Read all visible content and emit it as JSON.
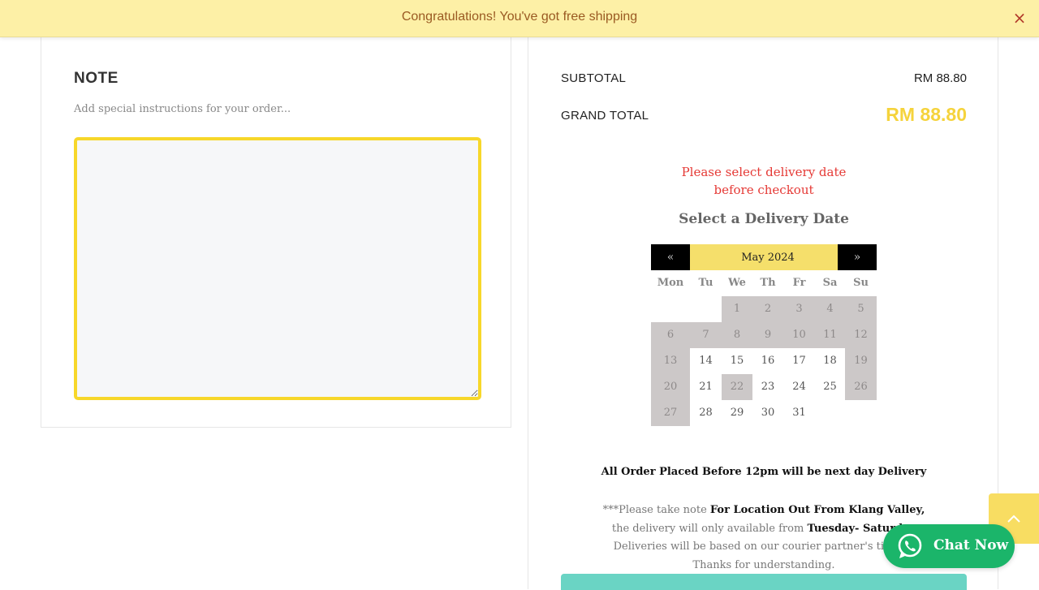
{
  "banner": {
    "message": "Congratulations! You've got free shipping",
    "close_icon": "×"
  },
  "note": {
    "title": "NOTE",
    "subtitle": "Add special instructions for your order...",
    "value": ""
  },
  "totals": {
    "subtotal_label": "SUBTOTAL",
    "subtotal_value": "RM 88.80",
    "grand_label": "GRAND TOTAL",
    "grand_value": "RM 88.80",
    "grand_color": "#f5d33c"
  },
  "delivery": {
    "warning": "Please select delivery date before checkout",
    "title": "Select a Delivery Date",
    "calendar": {
      "prev": "«",
      "next": "»",
      "month": "May 2024",
      "weekdays": [
        "Mon",
        "Tu",
        "We",
        "Th",
        "Fr",
        "Sa",
        "Su"
      ],
      "leading_blanks": 2,
      "days": [
        {
          "d": "1",
          "s": "na"
        },
        {
          "d": "2",
          "s": "na"
        },
        {
          "d": "3",
          "s": "na"
        },
        {
          "d": "4",
          "s": "na"
        },
        {
          "d": "5",
          "s": "na"
        },
        {
          "d": "6",
          "s": "na"
        },
        {
          "d": "7",
          "s": "na"
        },
        {
          "d": "8",
          "s": "na"
        },
        {
          "d": "9",
          "s": "na"
        },
        {
          "d": "10",
          "s": "na"
        },
        {
          "d": "11",
          "s": "na"
        },
        {
          "d": "12",
          "s": "na"
        },
        {
          "d": "13",
          "s": "na"
        },
        {
          "d": "14",
          "s": "ok"
        },
        {
          "d": "15",
          "s": "ok"
        },
        {
          "d": "16",
          "s": "ok"
        },
        {
          "d": "17",
          "s": "ok"
        },
        {
          "d": "18",
          "s": "ok"
        },
        {
          "d": "19",
          "s": "na"
        },
        {
          "d": "20",
          "s": "na"
        },
        {
          "d": "21",
          "s": "ok"
        },
        {
          "d": "22",
          "s": "na"
        },
        {
          "d": "23",
          "s": "ok"
        },
        {
          "d": "24",
          "s": "ok"
        },
        {
          "d": "25",
          "s": "ok"
        },
        {
          "d": "26",
          "s": "na"
        },
        {
          "d": "27",
          "s": "na"
        },
        {
          "d": "28",
          "s": "ok"
        },
        {
          "d": "29",
          "s": "ok"
        },
        {
          "d": "30",
          "s": "ok"
        },
        {
          "d": "31",
          "s": "ok"
        }
      ]
    }
  },
  "info": {
    "line1": "All Order Placed Before 12pm will be next day Delivery",
    "line2_prefix": "***Please take note ",
    "line2_bold": "For Location Out From Klang Valley,",
    "line3_prefix": "the delivery will only available from ",
    "line3_bold": "Tuesday- Saturday",
    "line4": "Deliveries will be based on our courier partner's timing.",
    "line5": "Thanks for understanding."
  },
  "chat": {
    "label": "Chat Now",
    "icon": "whatsapp-icon"
  },
  "scroll_top": {
    "icon": "chevron-up-icon"
  }
}
